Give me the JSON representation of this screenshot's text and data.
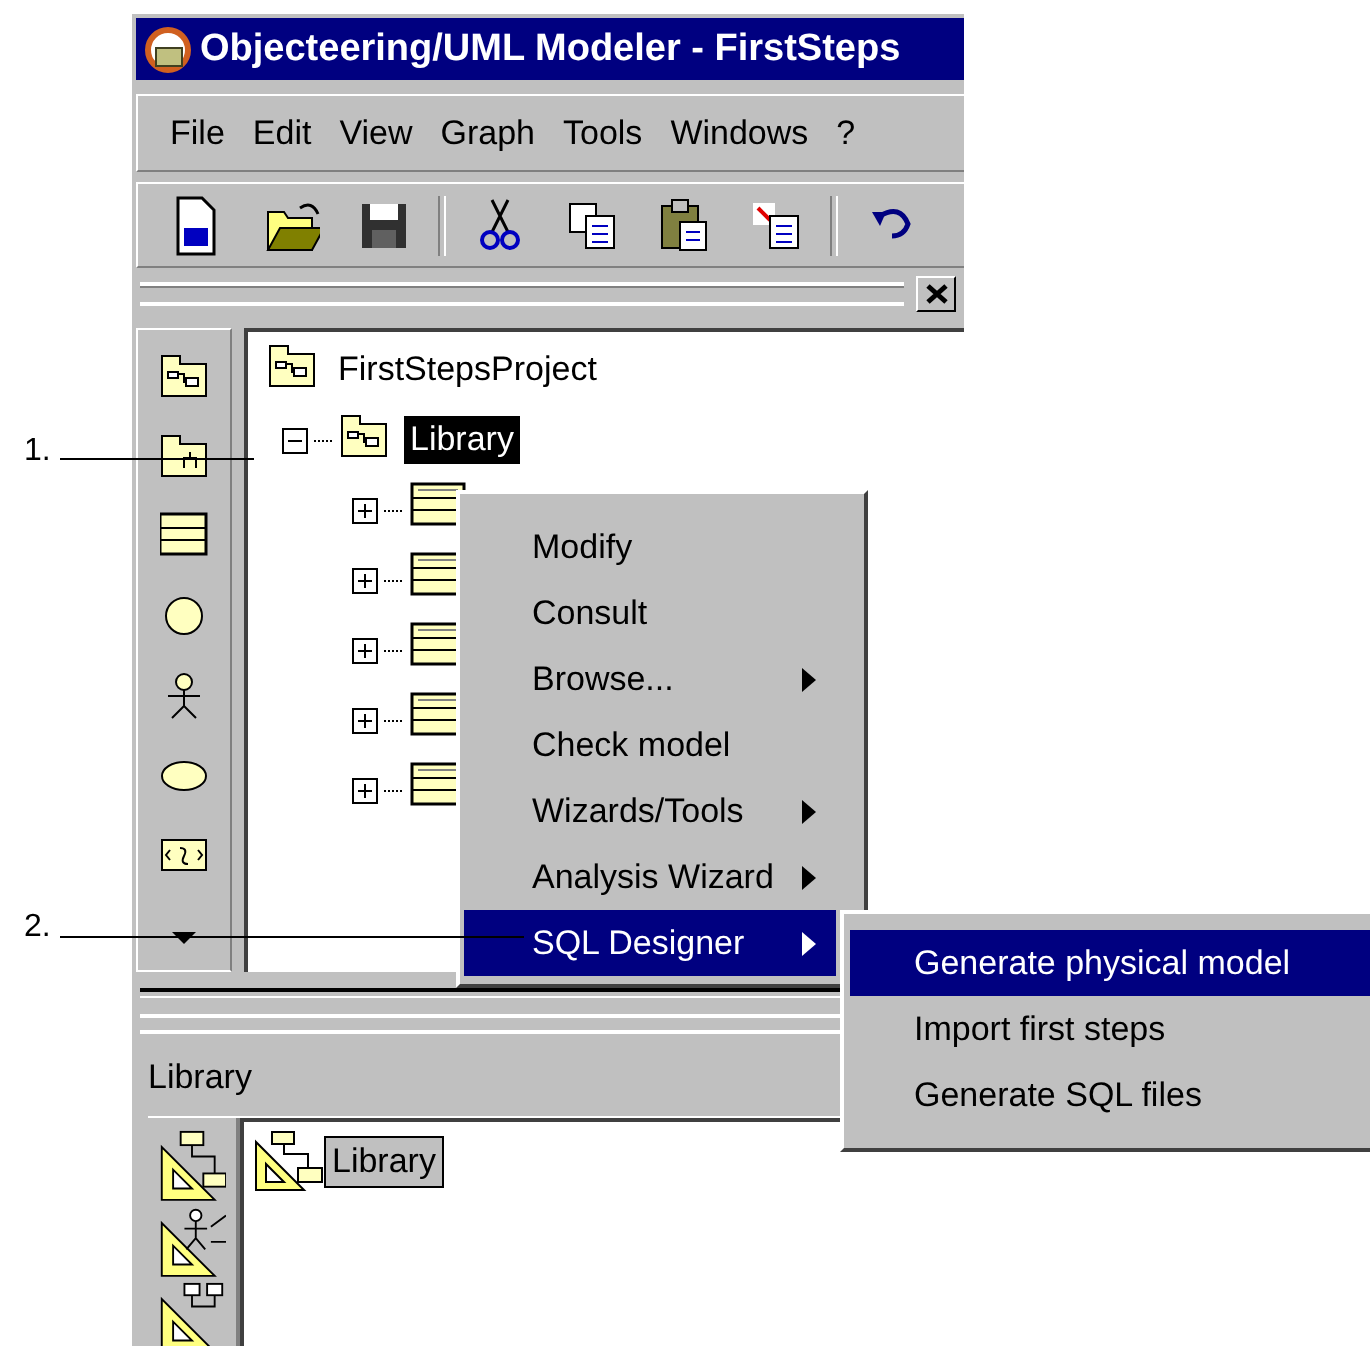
{
  "window": {
    "title": "Objecteering/UML Modeler - FirstSteps"
  },
  "menu_bar": [
    "File",
    "Edit",
    "View",
    "Graph",
    "Tools",
    "Windows",
    "?"
  ],
  "tree": {
    "items": [
      {
        "kind": "package",
        "label": "FirstStepsProject",
        "selected": false,
        "children": [
          {
            "kind": "package",
            "label": "Library",
            "selected": true,
            "expanded": true,
            "children": [
              {
                "kind": "class",
                "expanded": false
              },
              {
                "kind": "class",
                "expanded": false
              },
              {
                "kind": "class",
                "expanded": false
              },
              {
                "kind": "class",
                "expanded": false
              },
              {
                "kind": "class",
                "expanded": false
              }
            ]
          }
        ]
      }
    ]
  },
  "context_menu": {
    "items": [
      {
        "label": "Modify",
        "submenu": false,
        "selected": false
      },
      {
        "label": "Consult",
        "submenu": false,
        "selected": false
      },
      {
        "label": "Browse...",
        "submenu": true,
        "selected": false
      },
      {
        "label": "Check model",
        "submenu": false,
        "selected": false
      },
      {
        "label": "Wizards/Tools",
        "submenu": true,
        "selected": false
      },
      {
        "label": "Analysis Wizard",
        "submenu": true,
        "selected": false
      },
      {
        "label": "SQL Designer",
        "submenu": true,
        "selected": true
      }
    ]
  },
  "submenu": {
    "items": [
      {
        "label": "Generate physical model",
        "selected": true
      },
      {
        "label": "Import first steps",
        "selected": false
      },
      {
        "label": "Generate SQL files",
        "selected": false
      }
    ]
  },
  "bottom_panel": {
    "title": "Library",
    "items": [
      {
        "label": "Library",
        "selected": true
      }
    ]
  },
  "annotations": [
    {
      "label": "1.",
      "kind": "tree"
    },
    {
      "label": "2.",
      "kind": "menu"
    }
  ]
}
